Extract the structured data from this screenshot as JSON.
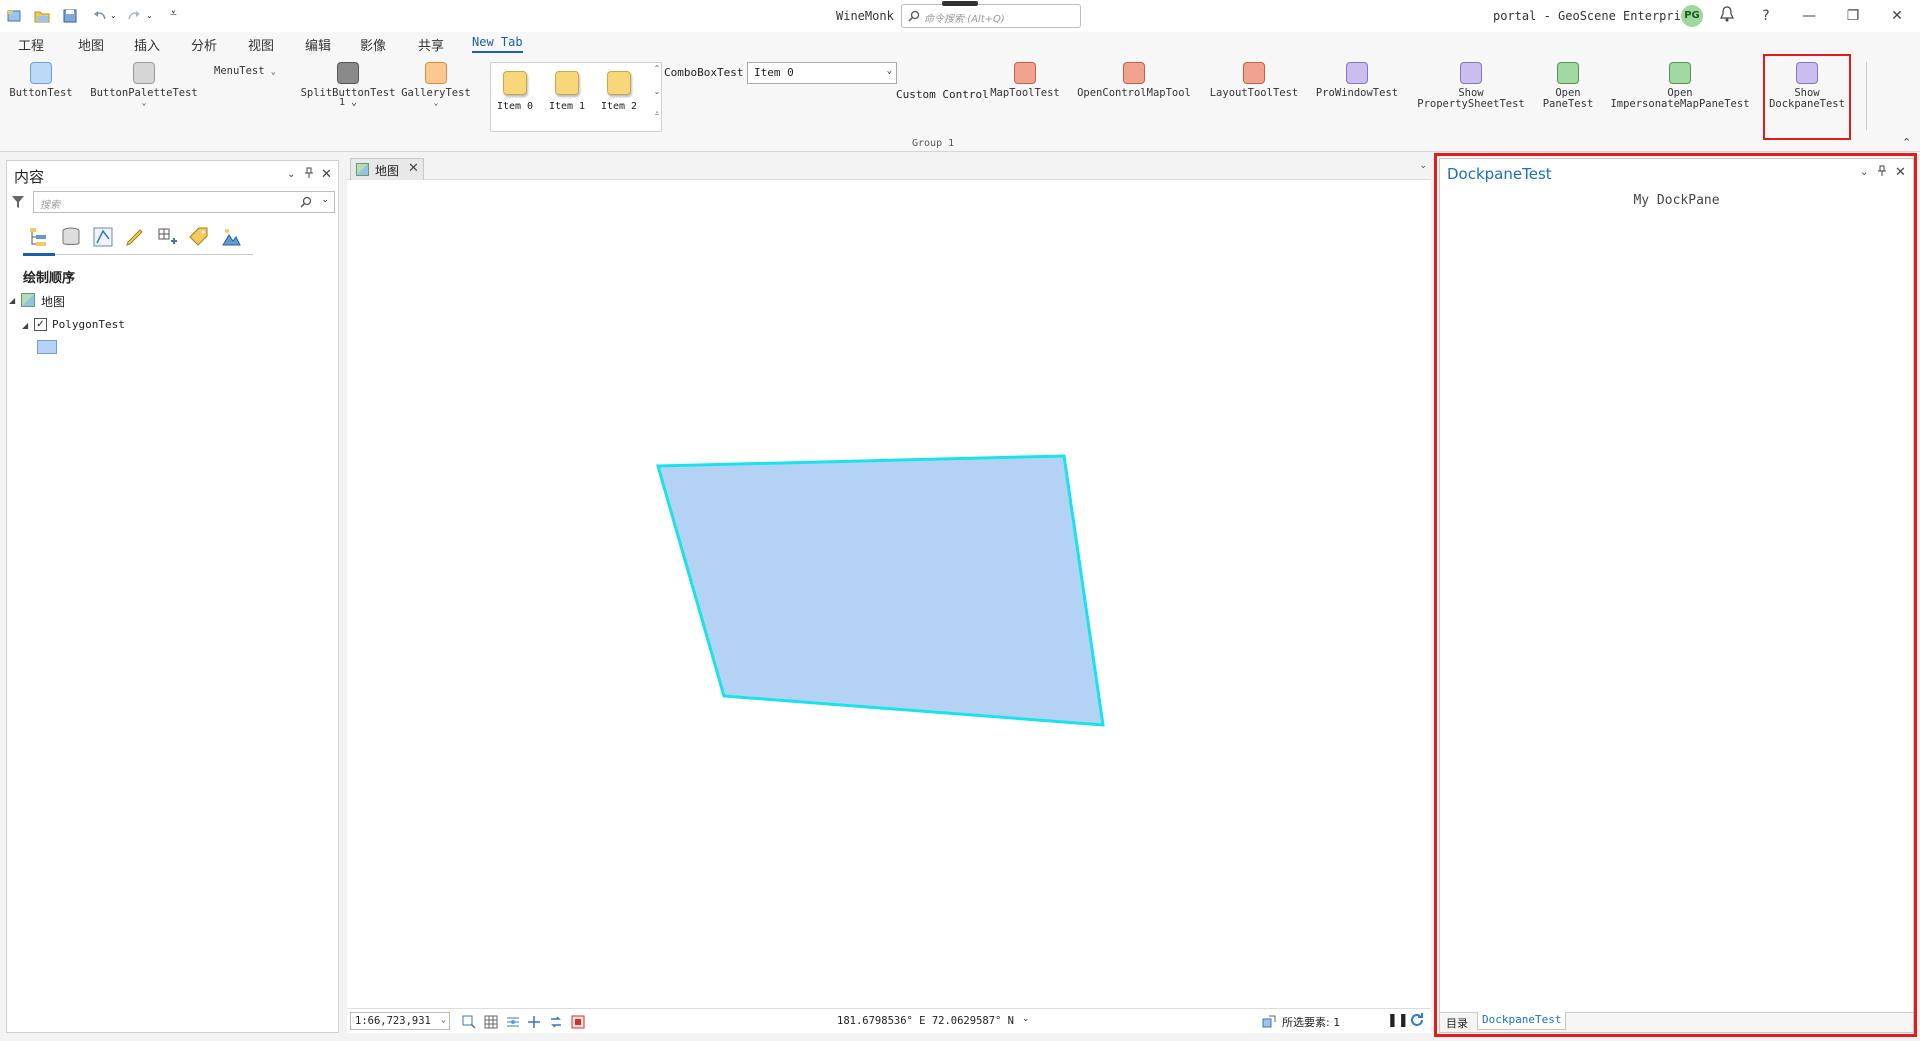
{
  "titlebar": {
    "app_title": "WineMonk",
    "search_placeholder": "命令搜索 (Alt+Q)",
    "portal": "portal - GeoScene Enterprise",
    "avatar": "PG",
    "minimize": "—",
    "restore": "❐",
    "close": "✕",
    "help": "?"
  },
  "ribbon_tabs": [
    "工程",
    "地图",
    "插入",
    "分析",
    "视图",
    "编辑",
    "影像",
    "共享",
    "New Tab"
  ],
  "ribbon": {
    "button_test": "ButtonTest",
    "button_palette_test": "ButtonPaletteTest",
    "menu_test": "MenuTest",
    "split_button_test": "SplitButtonTest",
    "split_button_sub": "1",
    "gallery_test": "GalleryTest",
    "gallery_items": [
      "Item 0",
      "Item 1",
      "Item 2"
    ],
    "combo_label": "ComboBoxTest",
    "combo_value": "Item 0",
    "custom_control": "Custom Control",
    "map_tool_test": "MapToolTest",
    "open_control_map_tool": "OpenControlMapTool",
    "layout_tool_test": "LayoutToolTest",
    "pro_window_test": "ProWindowTest",
    "show_property_sheet_1": "Show",
    "show_property_sheet_2": "PropertySheetTest",
    "open_pane_1": "Open",
    "open_pane_2": "PaneTest",
    "open_impersonate_1": "Open",
    "open_impersonate_2": "ImpersonateMapPaneTest",
    "show_dockpane_1": "Show",
    "show_dockpane_2": "DockpaneTest",
    "group_label": "Group 1"
  },
  "contents": {
    "title": "内容",
    "search_placeholder": "搜索",
    "draw_order": "绘制顺序",
    "map_label": "地图",
    "layer_label": "PolygonTest",
    "layer_checked": true
  },
  "map": {
    "tab_label": "地图",
    "scale": "1:66,723,931",
    "coordinates": "181.6798536° E 72.0629587° N",
    "selected_features": "所选要素: 1",
    "polygon_fill": "#b4d3f4",
    "polygon_stroke": "#19e3ea"
  },
  "dockpane": {
    "title": "DockpaneTest",
    "body_text": "My DockPane",
    "tabs": [
      "目录",
      "DockpaneTest"
    ]
  },
  "colors": {
    "accent": "#1a6fc1",
    "highlight": "#e21b1b"
  }
}
